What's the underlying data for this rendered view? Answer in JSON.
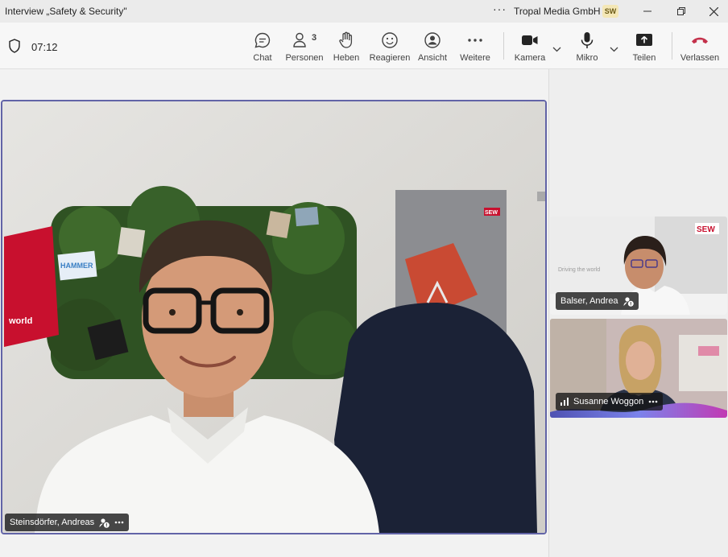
{
  "window": {
    "title": "Interview „Safety & Security\"",
    "more": "···",
    "organization": "Tropal Media GmbH",
    "user_initials": "SW"
  },
  "call": {
    "timer": "07:12",
    "people_count": "3"
  },
  "toolbar": {
    "chat": "Chat",
    "people": "Personen",
    "raise": "Heben",
    "react": "Reagieren",
    "view": "Ansicht",
    "more": "Weitere",
    "camera": "Kamera",
    "mic": "Mikro",
    "share": "Teilen",
    "leave": "Verlassen"
  },
  "participants": {
    "main": {
      "name": "Steinsdörfer, Andreas"
    },
    "thumb1": {
      "name": "Balser, Andrea",
      "logo": "SEW",
      "wall_text": "Driving the world"
    },
    "thumb2": {
      "name": "Susanne Woggon"
    }
  },
  "scene": {
    "hammer_sign": "HAMMER",
    "banner_text": "world",
    "poster_logo": "SEW"
  },
  "colors": {
    "accent": "#6264a7",
    "leave": "#c4314b"
  }
}
